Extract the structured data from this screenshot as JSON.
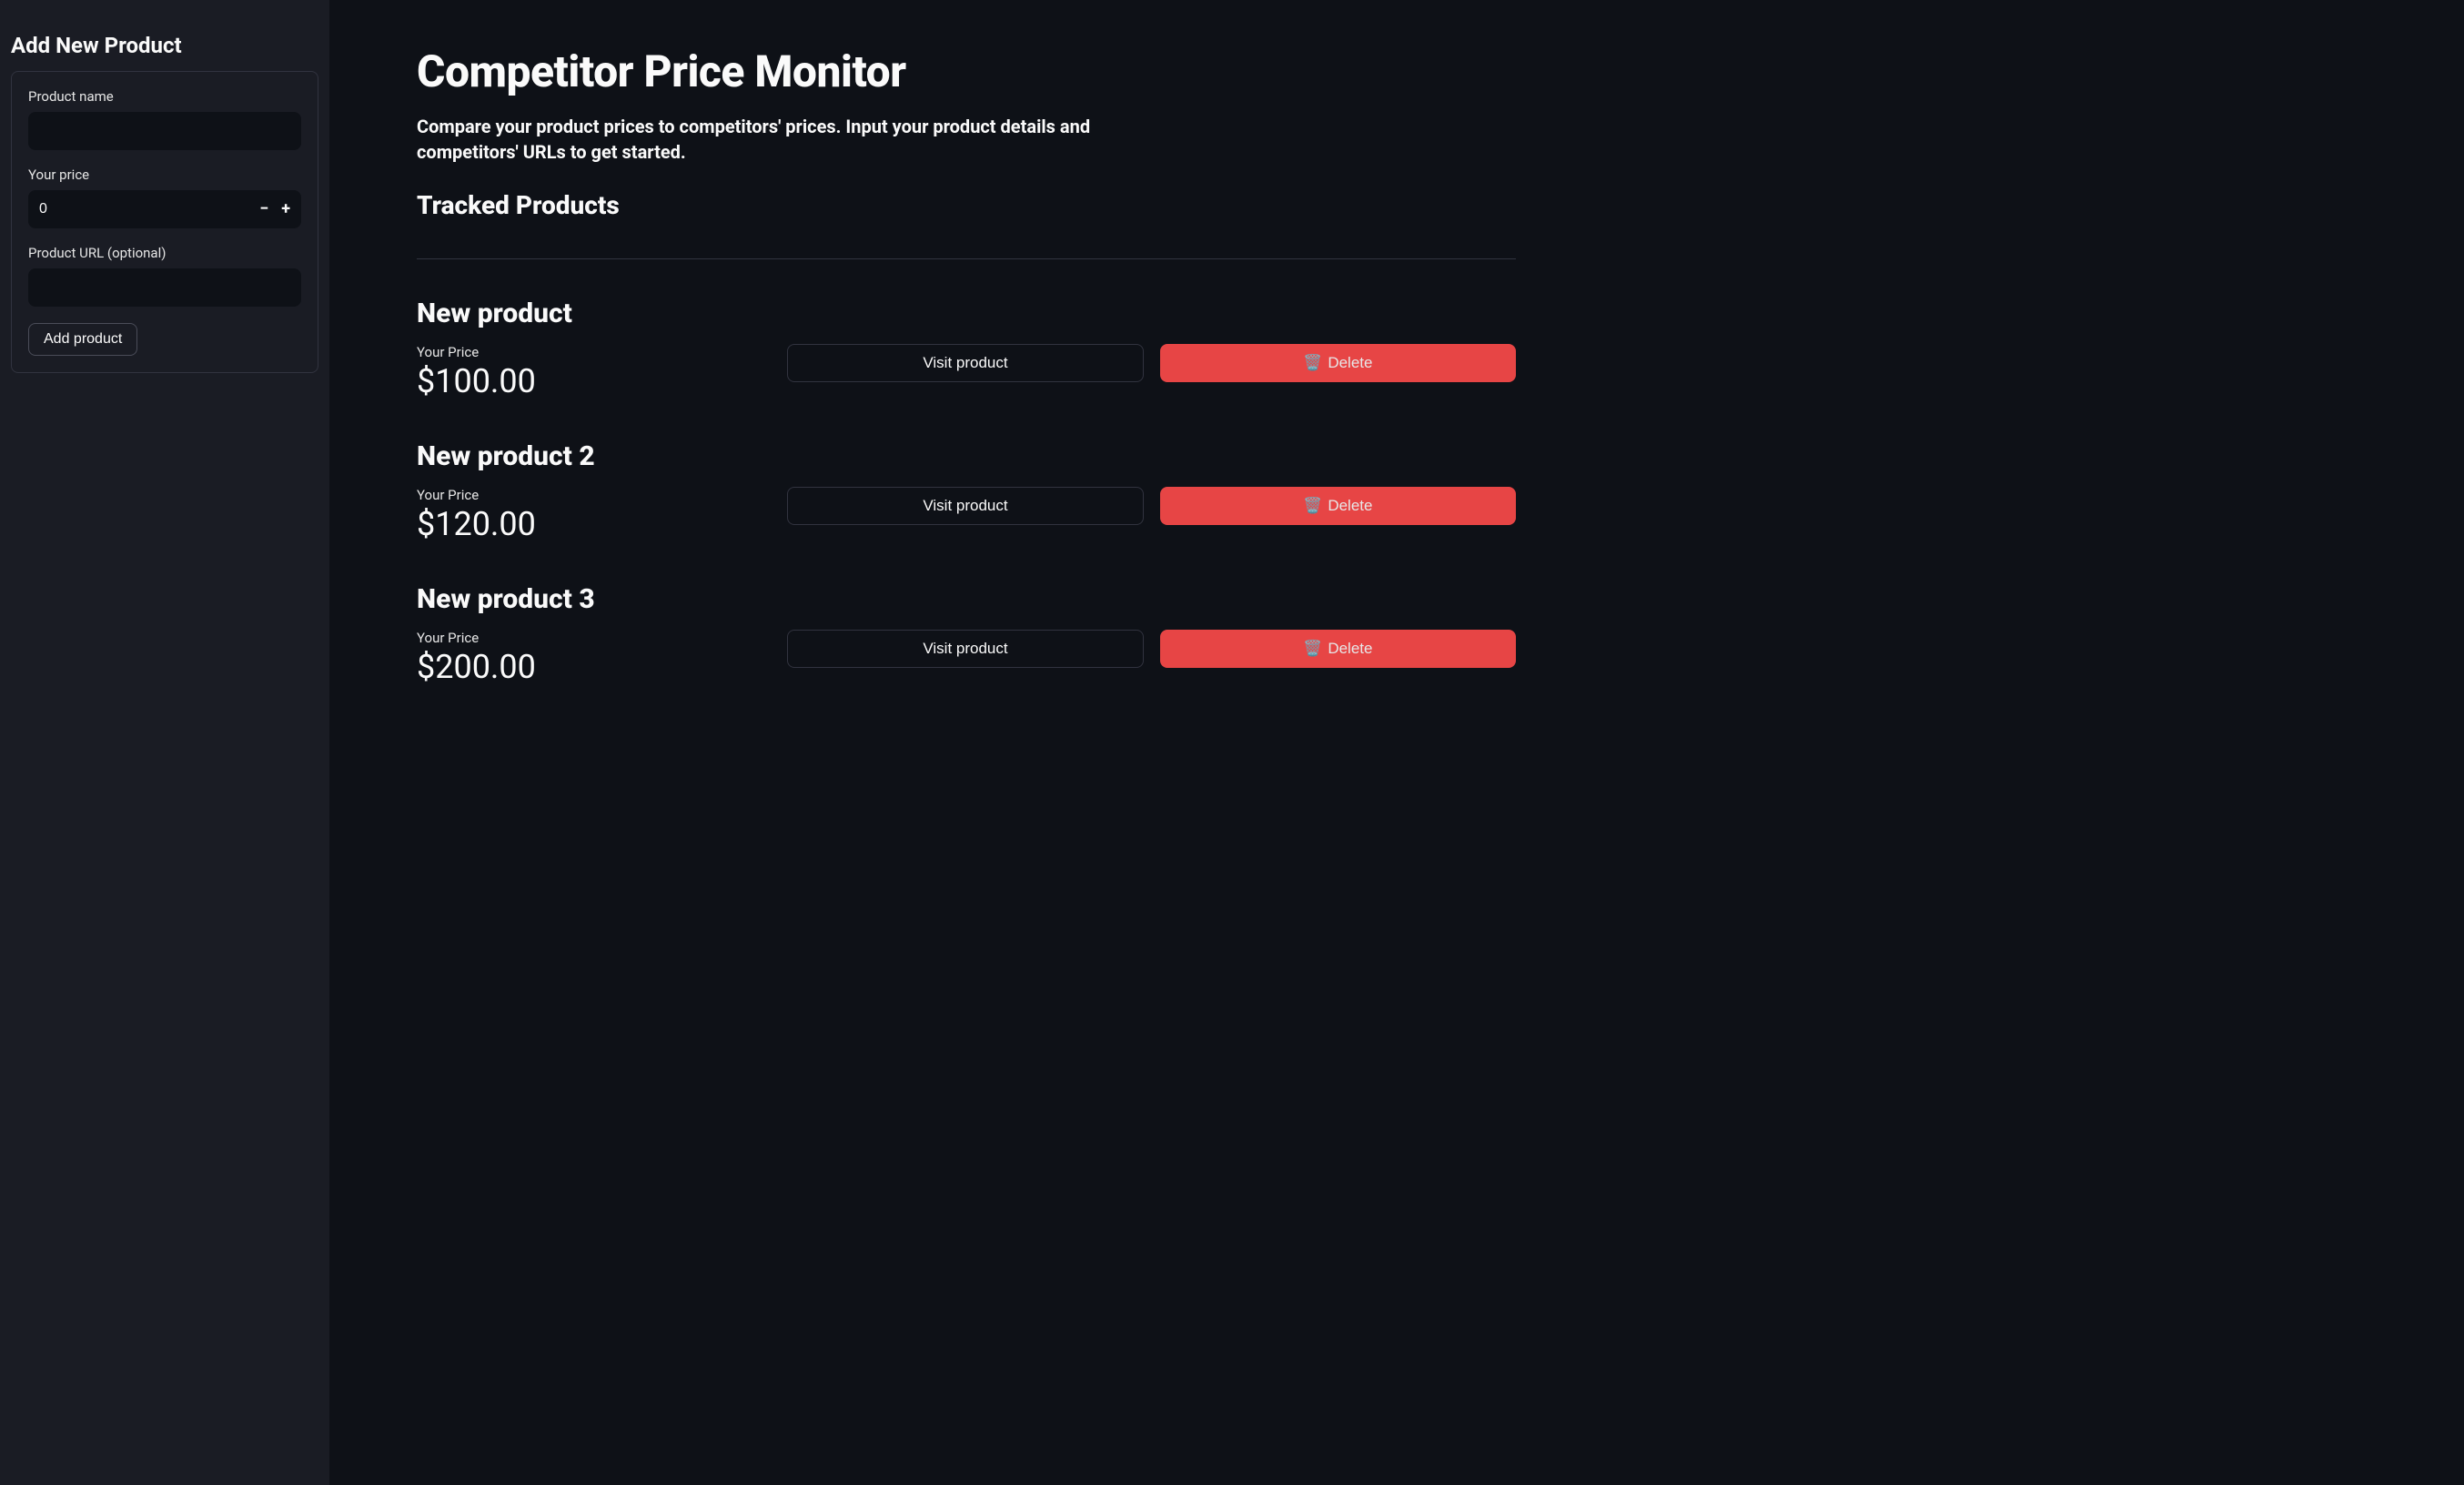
{
  "sidebar": {
    "heading": "Add New Product",
    "product_name_label": "Product name",
    "product_name_value": "",
    "your_price_label": "Your price",
    "your_price_value": "0",
    "product_url_label": "Product URL (optional)",
    "product_url_value": "",
    "add_button": "Add product",
    "stepper_minus": "−",
    "stepper_plus": "+"
  },
  "main": {
    "title": "Competitor Price Monitor",
    "subtitle": "Compare your product prices to competitors' prices. Input your product details and competitors' URLs to get started.",
    "section_title": "Tracked Products",
    "your_price_label": "Your Price",
    "visit_button": "Visit product",
    "delete_button": "Delete",
    "trash_icon": "🗑️",
    "products": [
      {
        "name": "New product",
        "price": "$100.00"
      },
      {
        "name": "New product 2",
        "price": "$120.00"
      },
      {
        "name": "New product 3",
        "price": "$200.00"
      }
    ]
  }
}
